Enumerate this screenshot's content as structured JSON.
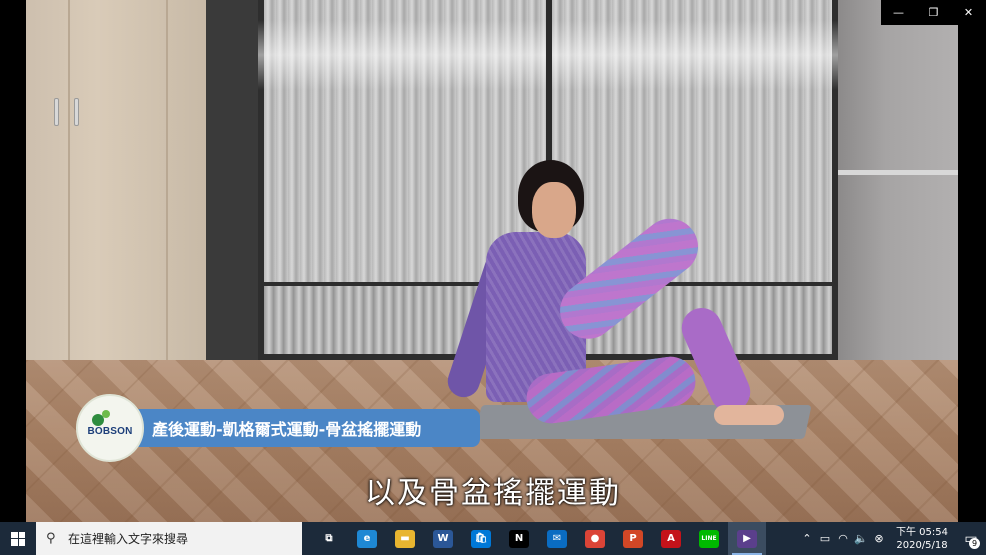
{
  "video": {
    "logo_brand": "BOBSON",
    "title": "產後運動-凱格爾式運動-骨盆搖擺運動",
    "subtitle": "以及骨盆搖擺運動"
  },
  "window_controls": {
    "minimize": "—",
    "restore": "❐",
    "close": "✕"
  },
  "taskbar": {
    "search_placeholder": "在這裡輸入文字來搜尋",
    "apps": [
      {
        "name": "task-view",
        "glyph": "⧉",
        "color": "#1c2a3a"
      },
      {
        "name": "edge",
        "glyph": "e",
        "color": "#1e88d4"
      },
      {
        "name": "file-explorer",
        "glyph": "▬",
        "color": "#e8b530"
      },
      {
        "name": "word",
        "glyph": "W",
        "color": "#2b5797"
      },
      {
        "name": "store",
        "glyph": "🛍",
        "color": "#0078d7"
      },
      {
        "name": "netflix",
        "glyph": "N",
        "color": "#000000"
      },
      {
        "name": "mail",
        "glyph": "✉",
        "color": "#0a6cc2"
      },
      {
        "name": "chrome",
        "glyph": "●",
        "color": "#db4437"
      },
      {
        "name": "ppt-app",
        "glyph": "P",
        "color": "#d24726"
      },
      {
        "name": "acrobat",
        "glyph": "A",
        "color": "#c4131a"
      },
      {
        "name": "line",
        "glyph": "LINE",
        "color": "#00b900"
      },
      {
        "name": "video-player",
        "glyph": "▶",
        "color": "#5b3f8c"
      }
    ],
    "clock_period_time": "下午 05:54",
    "clock_date": "2020/5/18",
    "notification_count": "9"
  }
}
